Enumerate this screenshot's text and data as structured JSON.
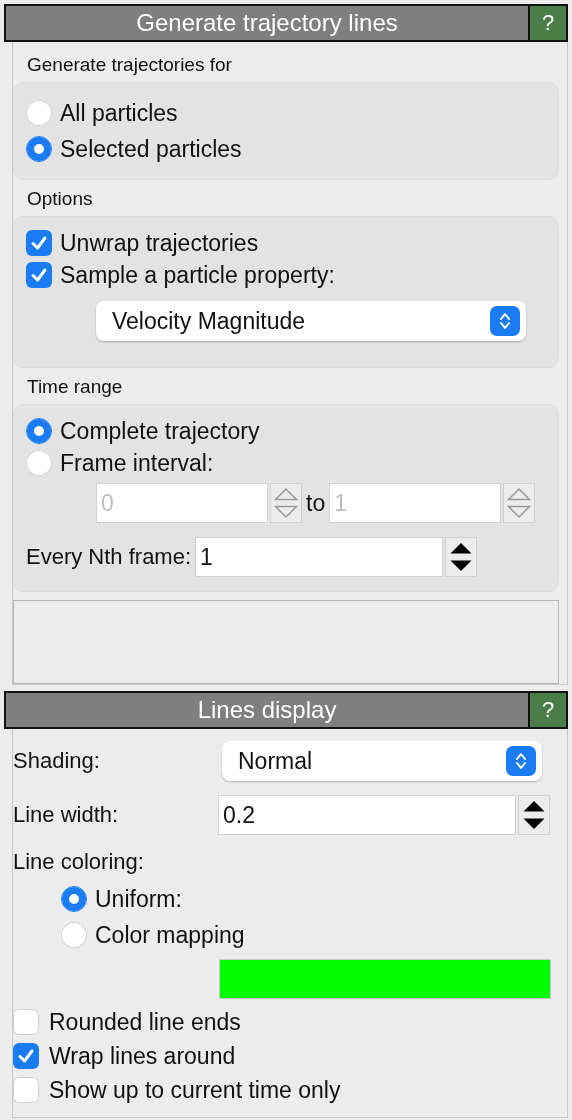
{
  "trajectory_panel": {
    "title": "Generate trajectory lines",
    "help": "?",
    "particles_group": {
      "title": "Generate trajectories for",
      "options": [
        {
          "label": "All particles",
          "selected": false
        },
        {
          "label": "Selected particles",
          "selected": true
        }
      ]
    },
    "options_group": {
      "title": "Options",
      "checkboxes": [
        {
          "label": "Unwrap trajectories",
          "checked": true
        },
        {
          "label": "Sample a particle property:",
          "checked": true
        }
      ],
      "property_select": {
        "value": "Velocity Magnitude"
      }
    },
    "time_range_group": {
      "title": "Time range",
      "options": [
        {
          "label": "Complete trajectory",
          "selected": true
        },
        {
          "label": "Frame interval:",
          "selected": false
        }
      ],
      "interval": {
        "start": "0",
        "separator": "to",
        "end": "1",
        "disabled": true
      },
      "every_nth": {
        "label": "Every Nth frame:",
        "value": "1"
      }
    }
  },
  "lines_panel": {
    "title": "Lines display",
    "help": "?",
    "shading": {
      "label": "Shading:",
      "value": "Normal"
    },
    "line_width": {
      "label": "Line width:",
      "value": "0.2"
    },
    "line_coloring": {
      "label": "Line coloring:",
      "options": [
        {
          "label": "Uniform:",
          "selected": true
        },
        {
          "label": "Color mapping",
          "selected": false
        }
      ],
      "swatch": {
        "color": "#00ff00"
      }
    },
    "checkboxes": [
      {
        "label": "Rounded line ends",
        "checked": false
      },
      {
        "label": "Wrap lines around",
        "checked": true
      },
      {
        "label": "Show up to current time only",
        "checked": false
      }
    ]
  }
}
